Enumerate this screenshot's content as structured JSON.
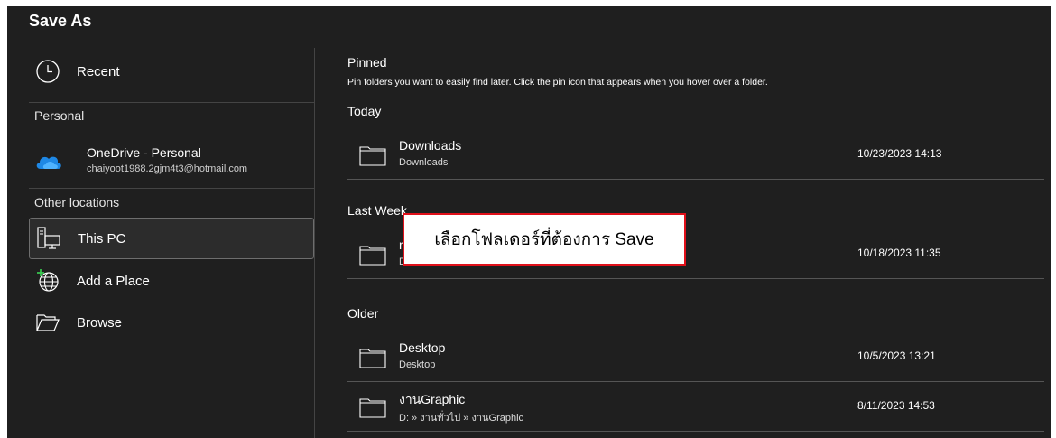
{
  "title": "Save As",
  "nav": {
    "recent": "Recent",
    "personal_header": "Personal",
    "onedrive": {
      "name": "OneDrive - Personal",
      "email": "chaiyoot1988.2gjm4t3@hotmail.com"
    },
    "other_header": "Other locations",
    "this_pc": "This PC",
    "add_place": "Add a Place",
    "browse": "Browse"
  },
  "pinned": {
    "header": "Pinned",
    "description": "Pin folders you want to easily find later. Click the pin icon that appears when you hover over a folder."
  },
  "groups": {
    "today": "Today",
    "last_week": "Last Week",
    "older": "Older"
  },
  "folders": [
    {
      "name": "Downloads",
      "path": "Downloads",
      "date": "10/23/2023 14:13"
    },
    {
      "name": "r",
      "path": "D",
      "date": "10/18/2023 11:35"
    },
    {
      "name": "Desktop",
      "path": "Desktop",
      "date": "10/5/2023 13:21"
    },
    {
      "name": "งานGraphic",
      "path": "D: » งานทั่วไป » งานGraphic",
      "date": "8/11/2023 14:53"
    }
  ],
  "callout": "เลือกโฟลเดอร์ที่ต้องการ Save",
  "colors": {
    "background": "#1f1f1f",
    "callout_border": "#e0101a",
    "onedrive_blue": "#1e88e5"
  }
}
